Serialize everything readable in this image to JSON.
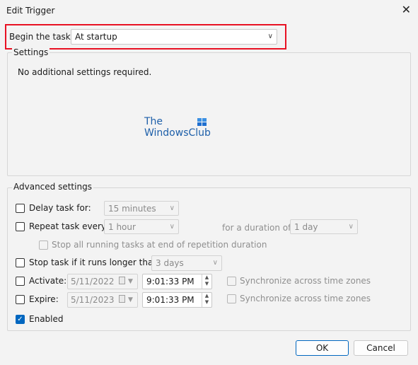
{
  "window": {
    "title": "Edit Trigger",
    "close_glyph": "✕"
  },
  "begin_task": {
    "label_prefix": "Begin the task:",
    "value": "At startup"
  },
  "settings": {
    "title": "Settings",
    "message": "No additional settings required.",
    "logo_line1": "The",
    "logo_line2": "WindowsClub"
  },
  "advanced": {
    "title": "Advanced settings",
    "delay": {
      "label": "Delay task for:",
      "checked": false,
      "value": "15 minutes"
    },
    "repeat": {
      "label": "Repeat task every:",
      "checked": false,
      "value": "1 hour",
      "duration_label": "for a duration of:",
      "duration_value": "1 day"
    },
    "stop_running": {
      "label": "Stop all running tasks at end of repetition duration",
      "checked": false
    },
    "stop_longer": {
      "label": "Stop task if it runs longer than:",
      "checked": false,
      "value": "3 days"
    },
    "activate": {
      "label": "Activate:",
      "checked": false,
      "date": "5/11/2022",
      "time": "9:01:33 PM",
      "sync_label": "Synchronize across time zones"
    },
    "expire": {
      "label": "Expire:",
      "checked": false,
      "date": "5/11/2023",
      "time": "9:01:33 PM",
      "sync_label": "Synchronize across time zones"
    },
    "enabled": {
      "label": "Enabled",
      "checked": true
    }
  },
  "buttons": {
    "ok": "OK",
    "cancel": "Cancel"
  },
  "icons": {
    "close": "close-icon",
    "dropdown": "chevron-down-icon",
    "calendar": "calendar-icon",
    "spinner": "spinner-icon",
    "check": "checkmark-icon"
  },
  "colors": {
    "highlight": "#e81123",
    "accent": "#0067c0",
    "logo_text": "#1d5fa9"
  }
}
